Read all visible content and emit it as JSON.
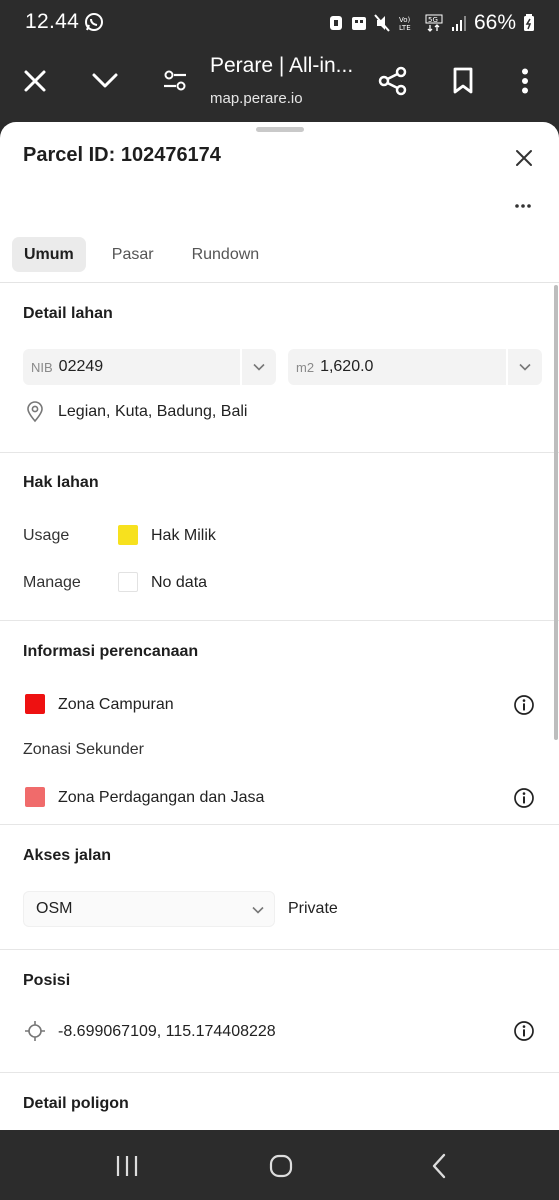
{
  "status_bar": {
    "time": "12.44",
    "battery": "66%"
  },
  "browser": {
    "title": "Perare | All-in...",
    "url": "map.perare.io"
  },
  "sheet": {
    "title": "Parcel ID: 102476174",
    "tabs": [
      "Umum",
      "Pasar",
      "Rundown"
    ]
  },
  "detail_lahan": {
    "title": "Detail lahan",
    "nib_prefix": "NIB",
    "nib_value": "02249",
    "area_prefix": "m2",
    "area_value": "1,620.0",
    "location": "Legian, Kuta, Badung, Bali"
  },
  "hak_lahan": {
    "title": "Hak lahan",
    "usage_label": "Usage",
    "usage_value": "Hak Milik",
    "usage_color": "#f7e11e",
    "manage_label": "Manage",
    "manage_value": "No data"
  },
  "informasi_perencanaan": {
    "title": "Informasi perencanaan",
    "primary_zone": "Zona Campuran",
    "primary_color": "#ee1111",
    "secondary_label": "Zonasi Sekunder",
    "secondary_zone": "Zona Perdagangan dan Jasa",
    "secondary_color": "#f06b6b"
  },
  "akses_jalan": {
    "title": "Akses jalan",
    "source": "OSM",
    "access_type": "Private"
  },
  "posisi": {
    "title": "Posisi",
    "coordinates": "-8.699067109, 115.174408228"
  },
  "detail_poligon": {
    "title": "Detail poligon"
  }
}
